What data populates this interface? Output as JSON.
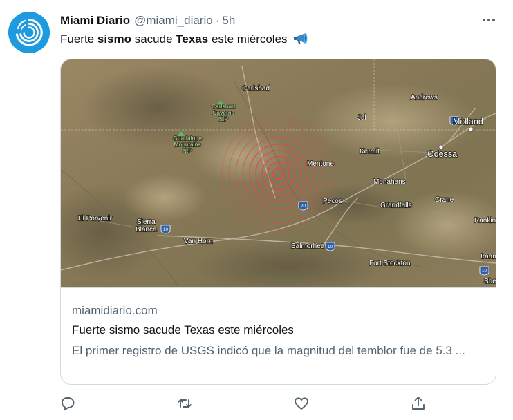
{
  "author": {
    "name": "Miami Diario",
    "handle": "@miami_diario",
    "separator": "·",
    "time": "5h",
    "avatar_icon": "spiral-logo-icon"
  },
  "tweet": {
    "text_parts": [
      "Fuerte ",
      "sismo",
      " sacude ",
      "Texas",
      " este miércoles"
    ],
    "emoji_icon": "megaphone-icon"
  },
  "card": {
    "domain": "miamidiario.com",
    "title": "Fuerte sismo sacude Texas este miércoles",
    "description": "El primer registro de USGS indicó que la magnitud del temblor fue de 5.3 ..."
  },
  "map": {
    "places": {
      "carlsbad": "Carlsbad",
      "andrews": "Andrews",
      "midland": "Midland",
      "jal": "Jal",
      "kermit": "Kermit",
      "odessa": "Odessa",
      "mentone": "Mentone",
      "monahans": "Monahans",
      "pecos": "Pecos",
      "grandfalls": "Grandfalls",
      "crane": "Crane",
      "el_porvenir": "El Porvenir",
      "sierra": "Sierra",
      "blanca": "Blanca",
      "van_horn": "Van Horn",
      "balmorhea": "Balmorhea",
      "fort_stockton": "Fort Stockton",
      "rankin": "Rankin",
      "iraan": "Iraan",
      "shef": "Shef"
    },
    "parks": {
      "carlsbad_line1": "Carlsbad",
      "carlsbad_line2": "Caverns",
      "carlsbad_line3": "N.P",
      "guadalupe_line1": "Guadalupe",
      "guadalupe_line2": "Mountains",
      "guadalupe_line3": "N.P"
    },
    "shields": {
      "i20_a": "20",
      "i20_b": "20",
      "i10_a": "10",
      "i10_b": "10",
      "i10_c": "10"
    },
    "colors": {
      "quake_ring": "#e2484b",
      "terrain": "#8d7a5a"
    }
  },
  "actions": {
    "reply_icon": "reply-icon",
    "retweet_icon": "retweet-icon",
    "like_icon": "like-icon",
    "share_icon": "share-icon"
  }
}
